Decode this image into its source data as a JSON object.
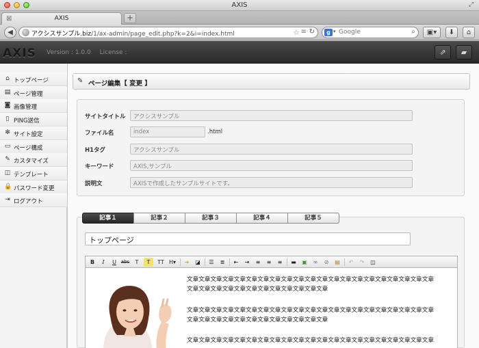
{
  "window": {
    "title": "AXIS",
    "tab_label": "AXIS"
  },
  "toolbar": {
    "url_domain": "アクシスサンプル.biz",
    "url_path": "/1/ax-admin/page_edit.php?k=2&i=index.html",
    "search_placeholder": "Google"
  },
  "app": {
    "logo": "AXIS",
    "version": "Version : 1.0.0",
    "license": "License :"
  },
  "sidebar": {
    "items": [
      {
        "label": "トップページ",
        "icon": "home-icon",
        "glyph": "⌂"
      },
      {
        "label": "ページ管理",
        "icon": "document-icon",
        "glyph": "▤"
      },
      {
        "label": "画像管理",
        "icon": "camera-icon",
        "glyph": "◙"
      },
      {
        "label": "PING送信",
        "icon": "file-icon",
        "glyph": "▯"
      },
      {
        "label": "サイト設定",
        "icon": "gear-icon",
        "glyph": "✻"
      },
      {
        "label": "ページ構成",
        "icon": "layout-icon",
        "glyph": "▭"
      },
      {
        "label": "カスタマイズ",
        "icon": "wrench-icon",
        "glyph": "✎"
      },
      {
        "label": "テンプレート",
        "icon": "columns-icon",
        "glyph": "◫"
      },
      {
        "label": "パスワード変更",
        "icon": "lock-icon",
        "glyph": "🔒"
      },
      {
        "label": "ログアウト",
        "icon": "logout-icon",
        "glyph": "⇥"
      }
    ]
  },
  "page": {
    "heading": "ページ編集【 変更 】",
    "fields": {
      "site_title_label": "サイトタイトル",
      "site_title_value": "アクシスサンプル",
      "file_name_label": "ファイル名",
      "file_name_value": "index",
      "file_name_suffix": ".html",
      "h1_label": "H1タグ",
      "h1_value": "アクシスサンプル",
      "keywords_label": "キーワード",
      "keywords_value": "AXIS,サンプル",
      "description_label": "説明文",
      "description_value": "AXISで作成したサンプルサイトです。"
    },
    "article_tabs": [
      "記事１",
      "記事２",
      "記事３",
      "記事４",
      "記事５"
    ],
    "active_tab": 0,
    "article_title": "トップページ",
    "editor": {
      "paragraphs": [
        {
          "line1": "文章文章文章文章文章文章文章文章文章文章文章文章文章文章文章文章文章文章文章文章文章",
          "line2": "文章文章文章文章文章文章文章文章文章文章文章文章"
        },
        {
          "line1": "文章文章文章文章文章文章文章文章文章文章文章文章文章文章文章文章文章文章文章文章文章",
          "line2": "文章文章文章文章文章文章文章文章文章文章文章文章"
        },
        {
          "line1": "文章文章文章文章文章文章文章文章文章文章文章文章文章文章文章文章文章文章文章文章文章",
          "line2": ""
        }
      ]
    }
  },
  "colors": {
    "header_dark": "#2a2a2a",
    "tab_active": "#262626",
    "sidebar_bg": "#f3f3f3"
  }
}
